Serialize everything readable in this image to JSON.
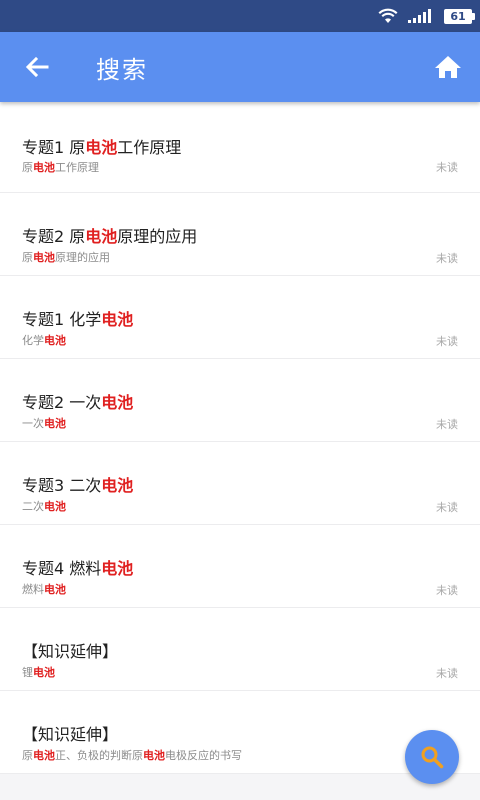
{
  "status": {
    "battery": "61",
    "icons": [
      "wifi-icon",
      "signal-icon",
      "battery-icon"
    ]
  },
  "appbar": {
    "title": "搜索",
    "back_icon": "arrow-left-icon",
    "home_icon": "home-icon"
  },
  "colors": {
    "appbar": "#5b8ff0",
    "statusbar": "#2f4a86",
    "highlight": "#e02020"
  },
  "items": [
    {
      "title": [
        "专题1 原",
        "电池",
        "工作原理"
      ],
      "sub": [
        "原",
        "电池",
        "工作原理"
      ],
      "status": "未读"
    },
    {
      "title": [
        "专题2 原",
        "电池",
        "原理的应用"
      ],
      "sub": [
        "原",
        "电池",
        "原理的应用"
      ],
      "status": "未读"
    },
    {
      "title": [
        "专题1 化学",
        "电池",
        ""
      ],
      "sub": [
        "化学",
        "电池",
        ""
      ],
      "status": "未读"
    },
    {
      "title": [
        "专题2 一次",
        "电池",
        ""
      ],
      "sub": [
        "一次",
        "电池",
        ""
      ],
      "status": "未读"
    },
    {
      "title": [
        "专题3 二次",
        "电池",
        ""
      ],
      "sub": [
        "二次",
        "电池",
        ""
      ],
      "status": "未读"
    },
    {
      "title": [
        "专题4 燃料",
        "电池",
        ""
      ],
      "sub": [
        "燃料",
        "电池",
        ""
      ],
      "status": "未读"
    },
    {
      "title": [
        "【知识延伸】",
        "",
        ""
      ],
      "sub": [
        "锂",
        "电池",
        ""
      ],
      "status": "未读"
    },
    {
      "title": [
        "【知识延伸】",
        "",
        ""
      ],
      "sub5": [
        "原",
        "电池",
        "正、负极的判断原",
        "电池",
        "电极反应的书写"
      ],
      "status": ""
    }
  ],
  "fab": {
    "icon": "search-icon"
  }
}
